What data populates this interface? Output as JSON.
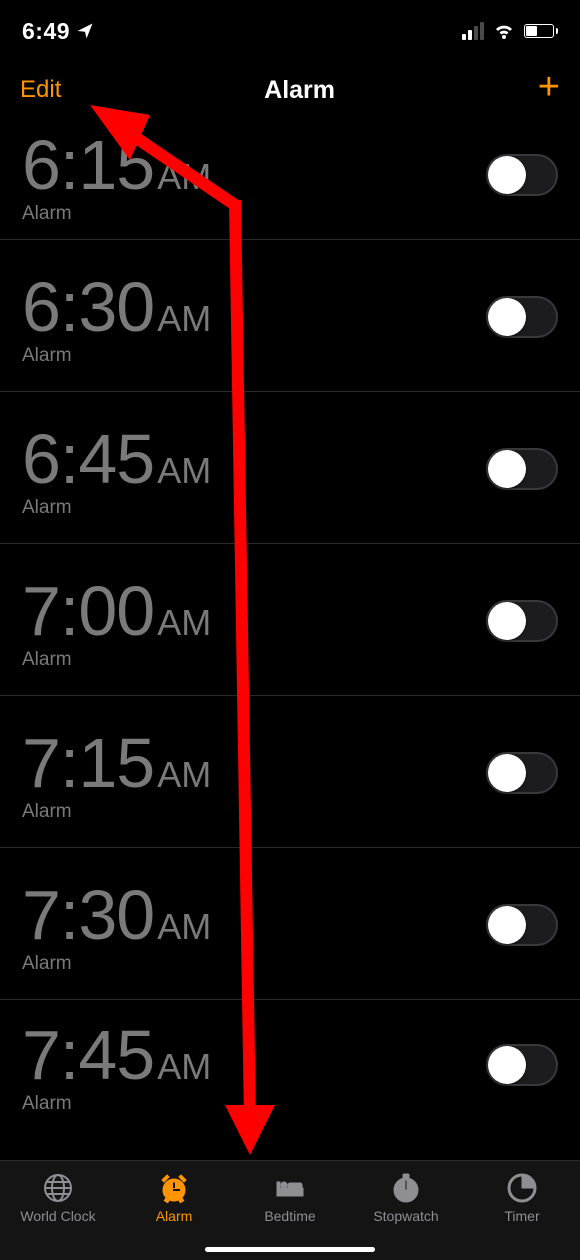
{
  "status": {
    "time": "6:49"
  },
  "nav": {
    "edit": "Edit",
    "title": "Alarm",
    "add": "+"
  },
  "alarms": [
    {
      "time": "6:15",
      "ampm": "AM",
      "label": "Alarm",
      "on": false
    },
    {
      "time": "6:30",
      "ampm": "AM",
      "label": "Alarm",
      "on": false
    },
    {
      "time": "6:45",
      "ampm": "AM",
      "label": "Alarm",
      "on": false
    },
    {
      "time": "7:00",
      "ampm": "AM",
      "label": "Alarm",
      "on": false
    },
    {
      "time": "7:15",
      "ampm": "AM",
      "label": "Alarm",
      "on": false
    },
    {
      "time": "7:30",
      "ampm": "AM",
      "label": "Alarm",
      "on": false
    },
    {
      "time": "7:45",
      "ampm": "AM",
      "label": "Alarm",
      "on": false
    }
  ],
  "tabs": [
    {
      "id": "world-clock",
      "label": "World Clock",
      "active": false
    },
    {
      "id": "alarm",
      "label": "Alarm",
      "active": true
    },
    {
      "id": "bedtime",
      "label": "Bedtime",
      "active": false
    },
    {
      "id": "stopwatch",
      "label": "Stopwatch",
      "active": false
    },
    {
      "id": "timer",
      "label": "Timer",
      "active": false
    }
  ],
  "colors": {
    "accent": "#ff9500",
    "annotation": "#ff0000"
  }
}
